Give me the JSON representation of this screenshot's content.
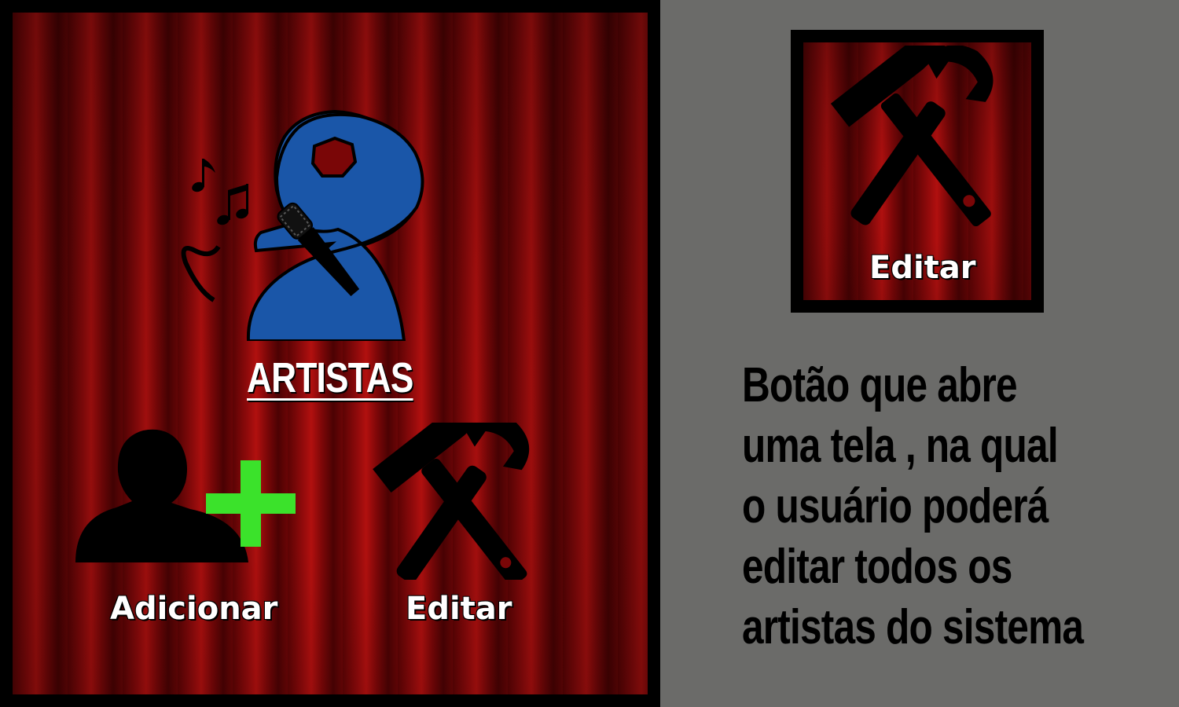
{
  "main_panel": {
    "title": "ARTISTAS",
    "buttons": {
      "add_label": "Adicionar",
      "edit_label": "Editar"
    },
    "icons": [
      "singer-icon",
      "add-user-icon",
      "tools-icon"
    ]
  },
  "preview": {
    "button_label": "Editar",
    "icon": "tools-icon"
  },
  "description": {
    "lines": [
      "Botão que abre",
      "uma tela , na qual",
      "o usuário poderá",
      "editar todos os",
      "artistas do sistema"
    ]
  },
  "colors": {
    "curtain_red": "#8e0a0b",
    "singer_blue": "#1a56a8",
    "plus_green": "#3be22b",
    "background_gray": "#6b6b69"
  }
}
